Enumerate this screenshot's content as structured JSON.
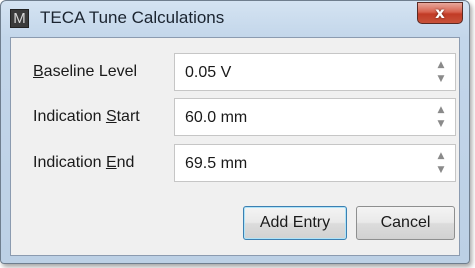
{
  "window": {
    "title": "TECA Tune Calculations",
    "app_icon_glyph": "M",
    "close_glyph": "x"
  },
  "fields": [
    {
      "label_pre": "",
      "label_key": "B",
      "label_post": "aseline Level",
      "value": "0.05 V"
    },
    {
      "label_pre": "Indication ",
      "label_key": "S",
      "label_post": "tart",
      "value": "60.0 mm"
    },
    {
      "label_pre": "Indication ",
      "label_key": "E",
      "label_post": "nd",
      "value": "69.5 mm"
    }
  ],
  "spinner": {
    "up_glyph": "▲",
    "down_glyph": "▼"
  },
  "buttons": {
    "add_entry": "Add Entry",
    "cancel": "Cancel"
  }
}
